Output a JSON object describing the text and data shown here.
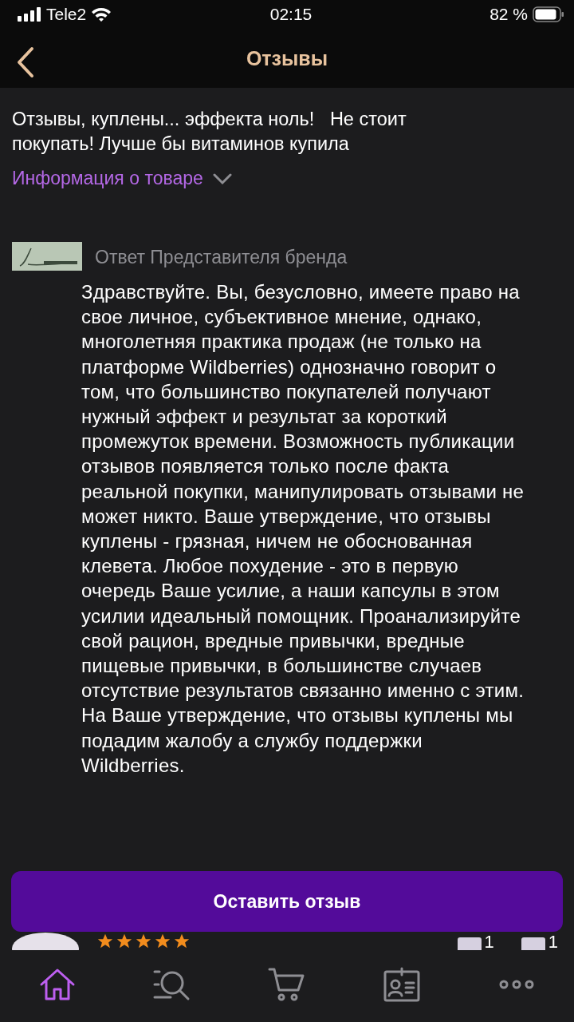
{
  "status_bar": {
    "carrier": "Tele2",
    "time": "02:15",
    "battery": "82 %"
  },
  "header": {
    "title": "Отзывы"
  },
  "review": {
    "text": "Отзывы, куплены... эффекта ноль!   Не стоит покупать! Лучше бы витаминов купила",
    "product_link": "Информация о товаре",
    "expanded": false
  },
  "brand_reply": {
    "author": "Ответ Представителя бренда",
    "text": "Здравствуйте. Вы, безусловно, имеете право на свое личное, субъективное мнение, однако, многолетняя практика продаж (не только на платформе Wildberries) однозначно говорит о том, что большинство покупателей получают нужный эффект и результат за короткий промежуток времени. Возможность публикации отзывов появляется только после факта реальной покупки, манипулировать отзывами не может никто. Ваше утверждение, что отзывы куплены - грязная, ничем не обоснованная клевета. Любое похудение - это в первую очередь Ваше усилие, а наши капсулы в этом усилии идеальный помощник. Проанализируйте свой рацион, вредные привычки, вредные пищевые привычки, в большинстве случаев отсутствие результатов связанно именно с этим. На Ваше утверждение, что отзывы куплены мы подадим жалобу а службу поддержки Wildberries."
  },
  "next_review": {
    "stars": 5,
    "likes": "1",
    "dislikes": "1"
  },
  "action_button": "Оставить отзыв",
  "tab_bar": [
    {
      "kind": "home",
      "selected": true
    },
    {
      "kind": "search",
      "selected": false
    },
    {
      "kind": "cart",
      "selected": false
    },
    {
      "kind": "profile",
      "selected": false
    },
    {
      "kind": "more",
      "selected": false
    }
  ]
}
